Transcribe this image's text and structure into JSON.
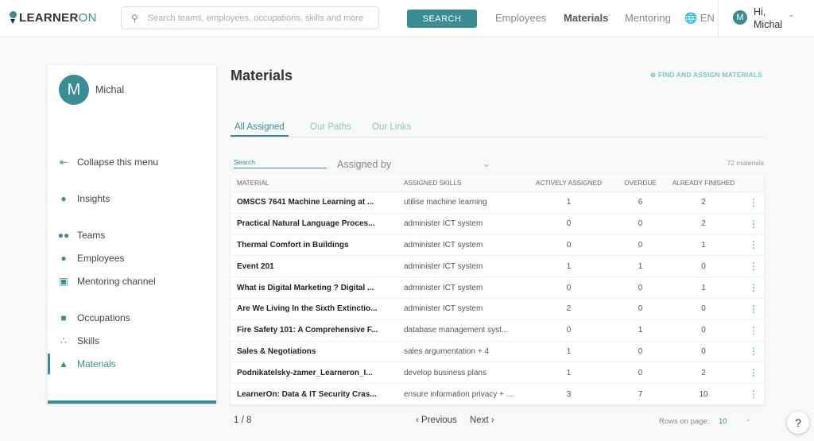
{
  "header": {
    "logo": "LEARNERON",
    "search_placeholder": "Search teams, employees, occupations, skills and more",
    "search_button": "SEARCH",
    "nav": [
      "Employees",
      "Materials",
      "Mentoring"
    ],
    "lang": "EN",
    "user_greeting": "Hi,",
    "user_name": "Michal",
    "avatar": "M"
  },
  "sidebar": {
    "user": "Michal",
    "avatar": "M",
    "items": [
      {
        "label": "Collapse this menu",
        "icon": "collapse-icon"
      },
      {
        "label": "Insights",
        "icon": "lightbulb-icon"
      },
      {
        "label": "Teams",
        "icon": "people-icon"
      },
      {
        "label": "Employees",
        "icon": "person-icon"
      },
      {
        "label": "Mentoring channel",
        "icon": "chat-icon"
      },
      {
        "label": "Occupations",
        "icon": "briefcase-icon"
      },
      {
        "label": "Skills",
        "icon": "skills-icon"
      },
      {
        "label": "Materials",
        "icon": "graduation-cap-icon"
      }
    ]
  },
  "main": {
    "title": "Materials",
    "find_link": "FIND AND ASSIGN MATERIALS",
    "tabs": [
      "All Assigned",
      "Our Paths",
      "Our Links"
    ],
    "search_label": "Search",
    "assigned_by": "Assigned by",
    "count": "72 materials",
    "columns": [
      "MATERIAL",
      "ASSIGNED SKILLS",
      "ACTIVELY ASSIGNED",
      "OVERDUE",
      "ALREADY FINISHED"
    ],
    "rows": [
      [
        "OMSCS 7641 Machine Learning at ...",
        "utilise machine learning",
        "1",
        "6",
        "2"
      ],
      [
        "Practical Natural Language Proces...",
        "administer ICT system",
        "0",
        "0",
        "2"
      ],
      [
        "Thermal Comfort in Buildings",
        "administer ICT system",
        "0",
        "0",
        "1"
      ],
      [
        "Event 201",
        "administer ICT system",
        "1",
        "1",
        "0"
      ],
      [
        "What is Digital Marketing ? Digital ...",
        "administer ICT system",
        "0",
        "0",
        "1"
      ],
      [
        "Are We Living In the Sixth Extinctio...",
        "administer ICT system",
        "2",
        "0",
        "0"
      ],
      [
        "Fire Safety 101: A Comprehensive F...",
        "database management syst...",
        "0",
        "1",
        "0"
      ],
      [
        "Sales & Negotiations",
        "sales argumentation + 4",
        "1",
        "0",
        "0"
      ],
      [
        "Podnikatelsky-zamer_Learneron_I...",
        "develop business plans",
        "1",
        "0",
        "2"
      ],
      [
        "LearnerOn: Data & IT Security Cras...",
        "ensure information privacy + ...",
        "3",
        "7",
        "10"
      ]
    ],
    "pagination": {
      "page": "1 / 8",
      "previous": "Previous",
      "next": "Next",
      "rows_label": "Rows on page:",
      "rows_value": "10"
    },
    "help": "?"
  }
}
